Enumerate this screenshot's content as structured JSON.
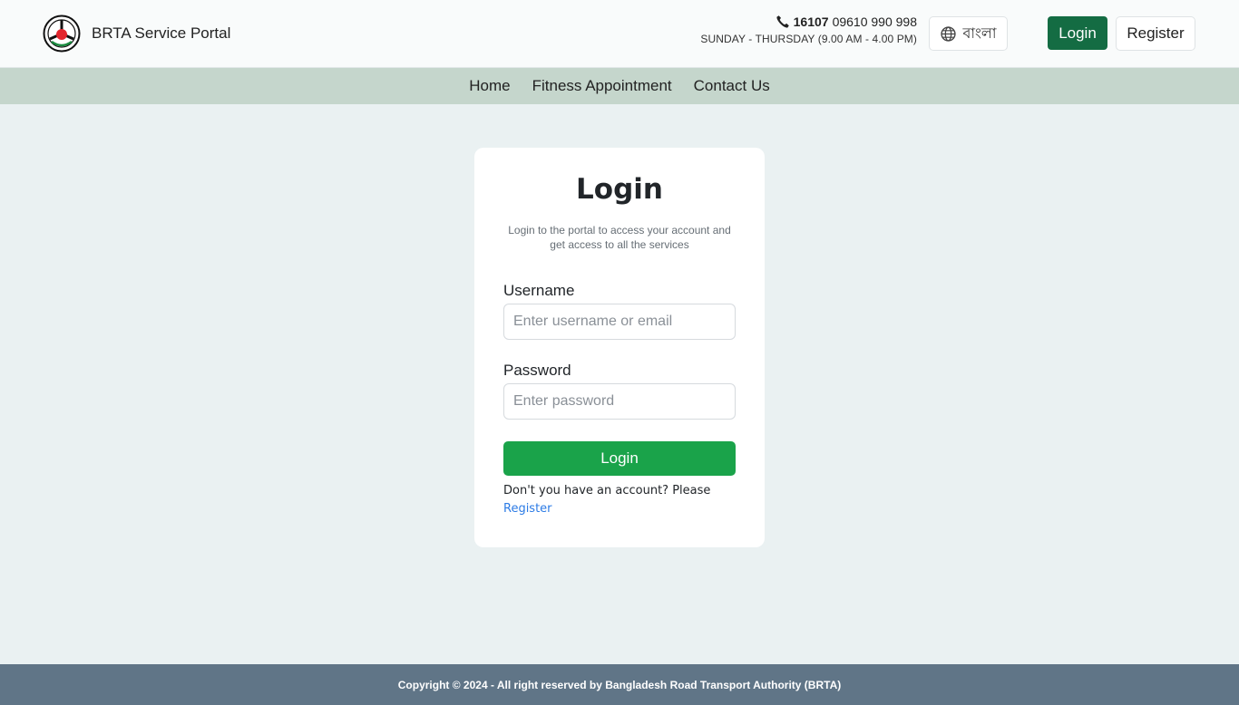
{
  "header": {
    "brand_name": "BRTA Service Portal",
    "hotline": "16107",
    "phone": "09610 990 998",
    "hours": "SUNDAY - THURSDAY (9.00 AM - 4.00 PM)",
    "language_label": "বাংলা",
    "login_label": "Login",
    "register_label": "Register"
  },
  "nav": {
    "items": [
      {
        "label": "Home"
      },
      {
        "label": "Fitness Appointment"
      },
      {
        "label": "Contact Us"
      }
    ]
  },
  "login_card": {
    "title": "Login",
    "subtitle": "Login to the portal to access your account and get access to all the services",
    "username_label": "Username",
    "username_placeholder": "Enter username or email",
    "username_value": "",
    "password_label": "Password",
    "password_placeholder": "Enter password",
    "password_value": "",
    "submit_label": "Login",
    "register_prompt": "Don't you have an account? Please",
    "register_link": "Register"
  },
  "footer": {
    "copyright": "Copyright © 2024 - All right reserved by Bangladesh Road Transport Authority (BRTA)"
  },
  "colors": {
    "primary_dark_green": "#146c43",
    "primary_green": "#1aa34a",
    "nav_bg": "#c5d6cc",
    "footer_bg": "#607587",
    "page_bg": "#eaf1f2",
    "link_blue": "#2c7be5"
  },
  "icons": {
    "logo": "brta-logo",
    "phone": "phone-icon",
    "language": "globe-icon"
  }
}
